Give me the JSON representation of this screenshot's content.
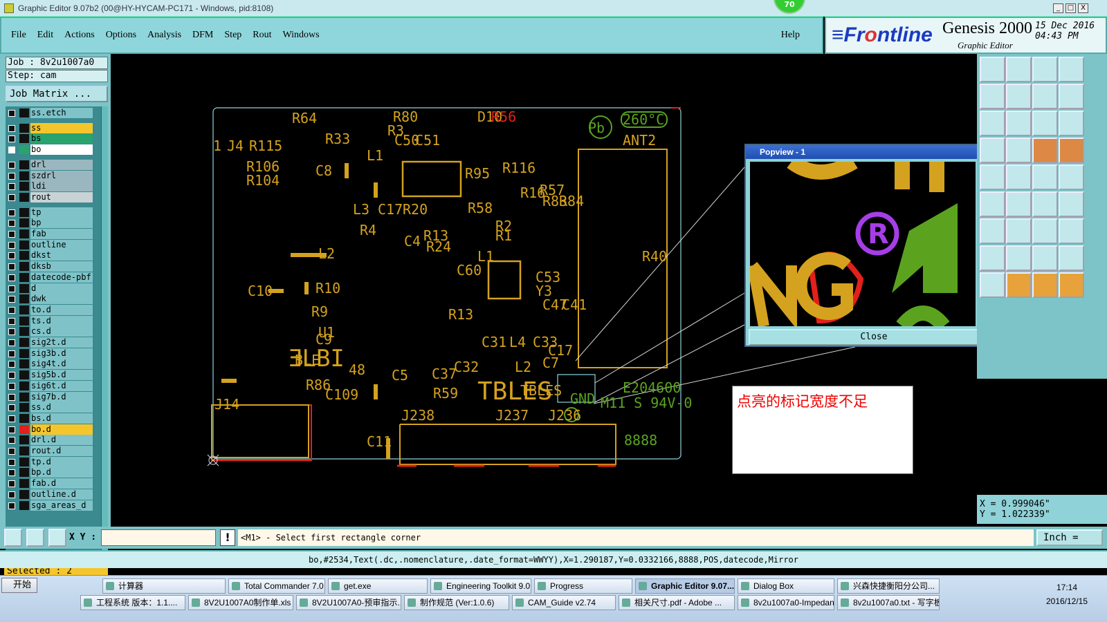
{
  "window": {
    "title": "Graphic Editor 9.07b2 (00@HY-HYCAM-PC171 - Windows, pid:8108)",
    "badge": "70",
    "min": "_",
    "max": "□",
    "close": "X"
  },
  "menu": {
    "items": [
      "File",
      "Edit",
      "Actions",
      "Options",
      "Analysis",
      "DFM",
      "Step",
      "Rout",
      "Windows"
    ],
    "help": "Help"
  },
  "brand": {
    "logo_a": "≡Fr",
    "logo_b": "o",
    "logo_c": "ntline",
    "product": "Genesis 2000",
    "sub": "Graphic Editor",
    "date": "15 Dec 2016",
    "time": "04:43 PM"
  },
  "left": {
    "job": "Job : 8v2u1007a0",
    "step": "Step: cam",
    "job_matrix": "Job Matrix ...",
    "layers": [
      {
        "name": "ss.etch",
        "color": "#7fc3c8"
      },
      {
        "name": "ss",
        "color": "#f5c62b"
      },
      {
        "name": "bs",
        "color": "#2aa36f"
      },
      {
        "name": "bo",
        "color": "#ffffff"
      },
      {
        "name": "drl",
        "color": "#9ab7c0"
      },
      {
        "name": "szdrl",
        "color": "#9ab7c0"
      },
      {
        "name": "ldi",
        "color": "#9ab7c0"
      },
      {
        "name": "rout",
        "color": "#c9d3d6"
      },
      {
        "name": "tp",
        "color": "#7fc3c8"
      },
      {
        "name": "bp",
        "color": "#7fc3c8"
      },
      {
        "name": "fab",
        "color": "#7fc3c8"
      },
      {
        "name": "outline",
        "color": "#7fc3c8"
      },
      {
        "name": "dkst",
        "color": "#7fc3c8"
      },
      {
        "name": "dksb",
        "color": "#7fc3c8"
      },
      {
        "name": "datecode-pbf",
        "color": "#7fc3c8"
      },
      {
        "name": "d",
        "color": "#7fc3c8"
      },
      {
        "name": "dwk",
        "color": "#7fc3c8"
      },
      {
        "name": "to.d",
        "color": "#7fc3c8"
      },
      {
        "name": "ts.d",
        "color": "#7fc3c8"
      },
      {
        "name": "cs.d",
        "color": "#7fc3c8"
      },
      {
        "name": "sig2t.d",
        "color": "#7fc3c8"
      },
      {
        "name": "sig3b.d",
        "color": "#7fc3c8"
      },
      {
        "name": "sig4t.d",
        "color": "#7fc3c8"
      },
      {
        "name": "sig5b.d",
        "color": "#7fc3c8"
      },
      {
        "name": "sig6t.d",
        "color": "#7fc3c8"
      },
      {
        "name": "sig7b.d",
        "color": "#7fc3c8"
      },
      {
        "name": "ss.d",
        "color": "#7fc3c8"
      },
      {
        "name": "bs.d",
        "color": "#7fc3c8"
      },
      {
        "name": "bo.d",
        "color": "#f5c62b"
      },
      {
        "name": "drl.d",
        "color": "#7fc3c8"
      },
      {
        "name": "rout.d",
        "color": "#7fc3c8"
      },
      {
        "name": "tp.d",
        "color": "#7fc3c8"
      },
      {
        "name": "bp.d",
        "color": "#7fc3c8"
      },
      {
        "name": "fab.d",
        "color": "#7fc3c8"
      },
      {
        "name": "outline.d",
        "color": "#7fc3c8"
      },
      {
        "name": "sga_areas_d",
        "color": "#7fc3c8"
      }
    ],
    "selected": "Selected : 2"
  },
  "board": {
    "labels": [
      "R64",
      "R80",
      "D10",
      "R56",
      "260°C",
      "Pb",
      "ANT2",
      "R3",
      "R33",
      "C51",
      "C50",
      "R115",
      "J4",
      "1",
      "R106",
      "R104",
      "L1",
      "C8",
      "R95",
      "R116",
      "R16",
      "R57",
      "R83",
      "R84",
      "L3",
      "C17",
      "R20",
      "R58",
      "R2",
      "R1",
      "R4",
      "C4",
      "R13",
      "R24",
      "L2",
      "C10",
      "R10",
      "R9",
      "U1",
      "C60",
      "L1",
      "Y3",
      "C47",
      "C53",
      "C41",
      "R13",
      "L4",
      "C33",
      "C31",
      "C32",
      "C37",
      "R59",
      "C5",
      "R86",
      "48",
      "J14",
      "C109",
      "J238",
      "J237",
      "J236",
      "E204600",
      "M11 S 94V-0",
      "8888",
      "GND",
      "TBLES",
      "BLE",
      "C11",
      "L2",
      "C17",
      "C7",
      "C9",
      "R40"
    ],
    "big_text_1": "TBLES",
    "big_text_2": "ƎLBI",
    "big_c9": "C9"
  },
  "popview": {
    "title": "Popview - 1",
    "close_x": "✕",
    "close": "Close"
  },
  "note": {
    "text": "点亮的标记宽度不足"
  },
  "coords": {
    "x": "X = 0.999046\"",
    "y": "Y = 1.022339\""
  },
  "command": {
    "xy_label": "X Y :",
    "input": "",
    "excl": "!",
    "message": "<M1> - Select first rectangle corner",
    "units": "Inch ="
  },
  "status": "bo,#2534,Text(.dc,.nomenclature,.date_format=WWYY),X=1.290187,Y=0.0332166,8888,POS,datecode,Mirror",
  "taskbar": {
    "start": "开始",
    "row1": [
      "计算器",
      "Total Commander 7.0 ...",
      "get.exe",
      "Engineering Toolkit 9.0...",
      "Progress",
      "Graphic Editor 9.07...",
      "Dialog Box",
      "兴森快捷衡阳分公司..."
    ],
    "row2": [
      "工程系统  版本：1.1....",
      "8V2U1007A0制作单.xls ...",
      "8V2U1007A0-预审指示...",
      "制作规范 (Ver:1.0.6)",
      "CAM_Guide v2.74",
      "相关尺寸.pdf - Adobe ...",
      "8v2u1007a0-Impedance...",
      "8v2u1007a0.txt - 写字板"
    ],
    "time": "17:14",
    "date": "2016/12/15"
  },
  "colors": {
    "silk": "#d4a21e",
    "green": "#5ba31f",
    "red": "#e2201c",
    "outline": "#8fd6dc",
    "accent": "#8fd6dc"
  }
}
